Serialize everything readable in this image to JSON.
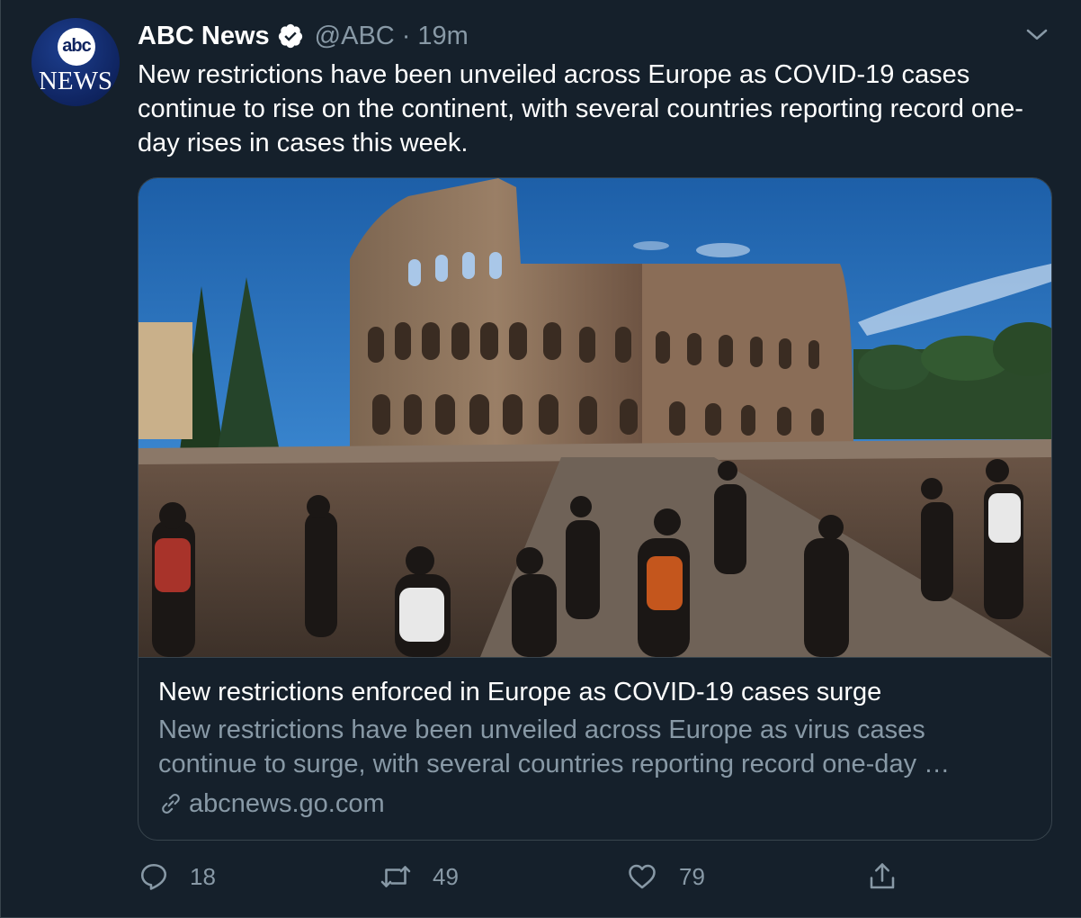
{
  "tweet": {
    "display_name": "ABC News",
    "handle": "@ABC",
    "separator": "·",
    "time": "19m",
    "text": "New restrictions have been unveiled across Europe as COVID-19 cases continue to rise on the continent, with several countries reporting record one-day rises in cases this week.",
    "avatar": {
      "logo_text": "abc",
      "wordmark": "NEWS"
    },
    "icons": {
      "verified": "verified-badge-icon",
      "menu": "chevron-down-icon"
    }
  },
  "card": {
    "image_description_icon": "colosseum-photo",
    "title": "New restrictions enforced in Europe as COVID-19 cases surge",
    "description": "New restrictions have been unveiled across Europe as virus cases continue to surge, with several countries reporting record one-day …",
    "domain": "abcnews.go.com"
  },
  "actions": {
    "reply": {
      "icon": "reply-icon",
      "count": "18"
    },
    "retweet": {
      "icon": "retweet-icon",
      "count": "49"
    },
    "like": {
      "icon": "heart-icon",
      "count": "79"
    },
    "share": {
      "icon": "share-icon"
    }
  },
  "colors": {
    "background": "#15202b",
    "border": "#38444d",
    "secondary_text": "#8899a6",
    "primary_text": "#ffffff"
  }
}
